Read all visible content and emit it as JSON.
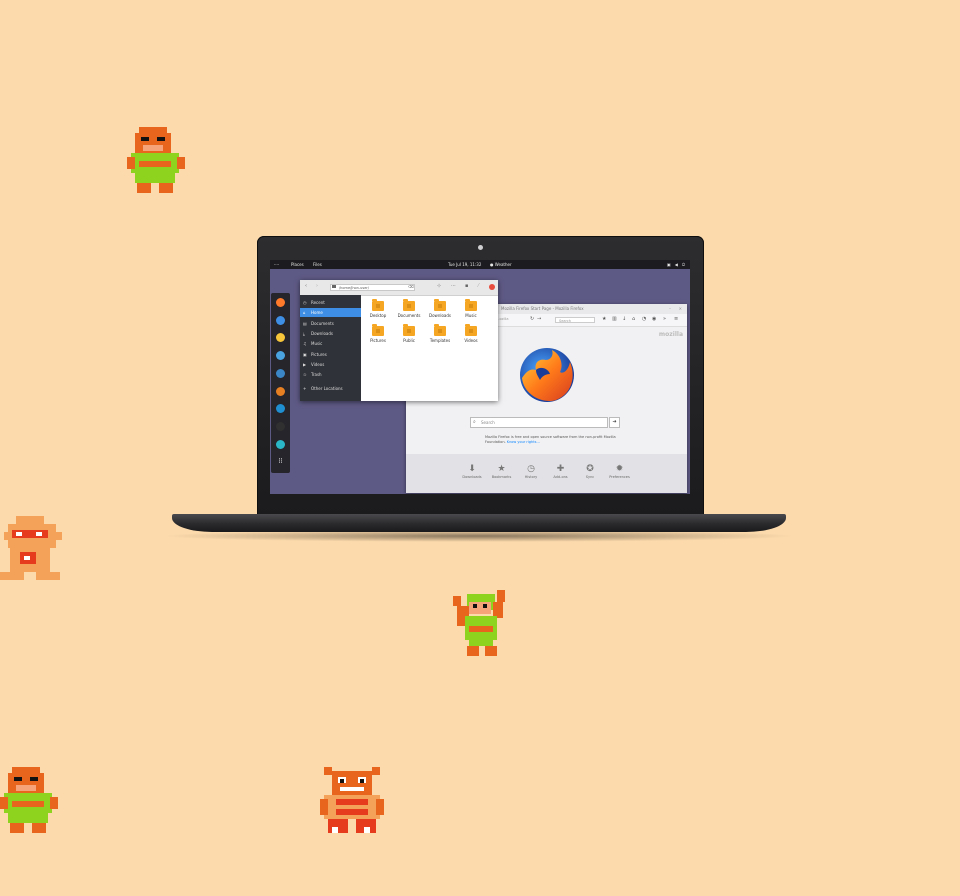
{
  "topbar": {
    "activities": "····",
    "places": "Places",
    "files_menu": "Files",
    "clock": "Tue Jul 19, 11:32",
    "weather": "Weather"
  },
  "dock": {
    "apps": [
      {
        "name": "firefox",
        "color": "#ff7a2a"
      },
      {
        "name": "mail",
        "color": "#3d8ee4"
      },
      {
        "name": "music",
        "color": "#f6c53a"
      },
      {
        "name": "files",
        "color": "#4aa3df"
      },
      {
        "name": "software",
        "color": "#3b86c6"
      },
      {
        "name": "photos",
        "color": "#e67e22"
      },
      {
        "name": "web",
        "color": "#1f8fd1"
      },
      {
        "name": "terminal",
        "color": "#303030"
      },
      {
        "name": "clock",
        "color": "#2ab6c7"
      },
      {
        "name": "app-grid",
        "color": "#25252b"
      }
    ]
  },
  "files": {
    "path": "/home/Jhon-user/",
    "sidebar": [
      {
        "label": "Recent",
        "icon": "◷"
      },
      {
        "label": "Home",
        "icon": "⌂",
        "active": true
      },
      {
        "label": "Documents",
        "icon": "▤"
      },
      {
        "label": "Downloads",
        "icon": "⤓"
      },
      {
        "label": "Music",
        "icon": "♫"
      },
      {
        "label": "Pictures",
        "icon": "▣"
      },
      {
        "label": "Videos",
        "icon": "▶"
      },
      {
        "label": "Trash",
        "icon": "♲"
      },
      {
        "label": "Other Locations",
        "icon": "+"
      }
    ],
    "folders": [
      "Desktop",
      "Documents",
      "Downloads",
      "Music",
      "Pictures",
      "Public",
      "Templates",
      "Videos"
    ]
  },
  "firefox": {
    "title": "Mozilla Firefox Start Page - Mozilla Firefox",
    "url_tail": "…ozilla",
    "search_placeholder": "Search",
    "brand": "mozilla",
    "main_search_placeholder": "Search",
    "notice": "Mozilla Firefox is free and open source software from the non-profit Mozilla Foundation.",
    "notice_link": "Know your rights…",
    "launchers": [
      "Downloads",
      "Bookmarks",
      "History",
      "Add-ons",
      "Sync",
      "Preferences"
    ]
  },
  "colors": {
    "background": "#fcdaac",
    "desktop": "#5e5a86",
    "accent": "#3d8ee4",
    "folder": "#f5a623"
  }
}
